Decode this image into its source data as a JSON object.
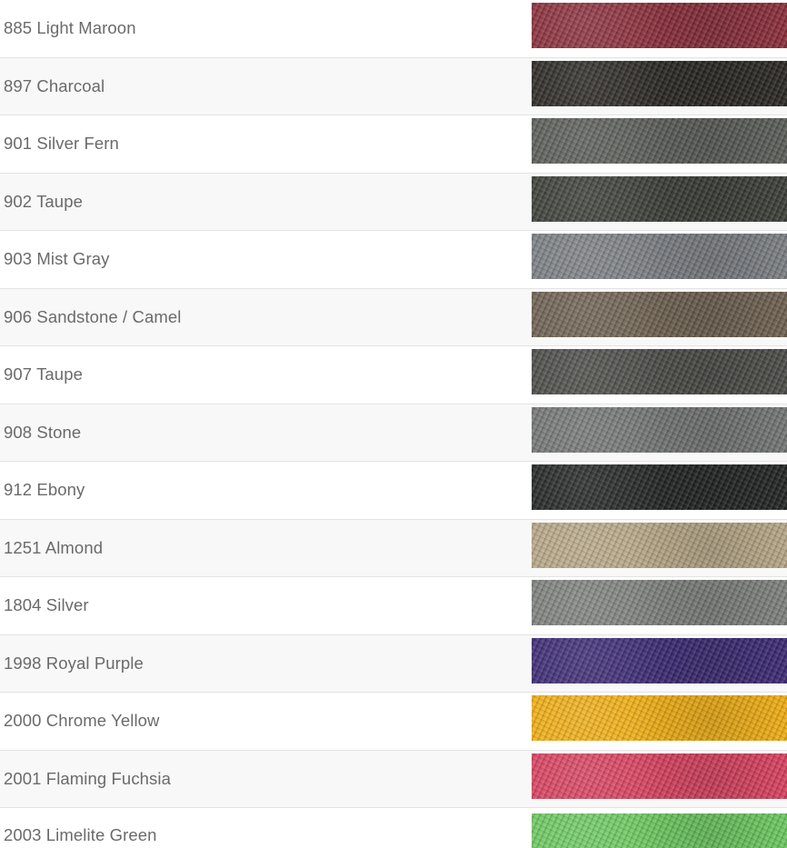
{
  "colors": [
    {
      "label": "885 Light Maroon",
      "swatch": "#8a2e3a"
    },
    {
      "label": "897 Charcoal",
      "swatch": "#2a2724"
    },
    {
      "label": "901 Silver Fern",
      "swatch": "#5a5c58"
    },
    {
      "label": "902 Taupe",
      "swatch": "#3b3d37"
    },
    {
      "label": "903 Mist Gray",
      "swatch": "#7b7e82"
    },
    {
      "label": "906 Sandstone / Camel",
      "swatch": "#6d6050"
    },
    {
      "label": "907 Taupe",
      "swatch": "#4a4b47"
    },
    {
      "label": "908 Stone",
      "swatch": "#737474"
    },
    {
      "label": "912 Ebony",
      "swatch": "#222423"
    },
    {
      "label": "1251 Almond",
      "swatch": "#b6a686"
    },
    {
      "label": "1804 Silver",
      "swatch": "#7d807d"
    },
    {
      "label": "1998 Royal Purple",
      "swatch": "#3b2a73"
    },
    {
      "label": "2000 Chrome Yellow",
      "swatch": "#efad14"
    },
    {
      "label": "2001 Flaming Fuchsia",
      "swatch": "#d8415f"
    },
    {
      "label": "2003 Limelite Green",
      "swatch": "#6cc860"
    }
  ]
}
